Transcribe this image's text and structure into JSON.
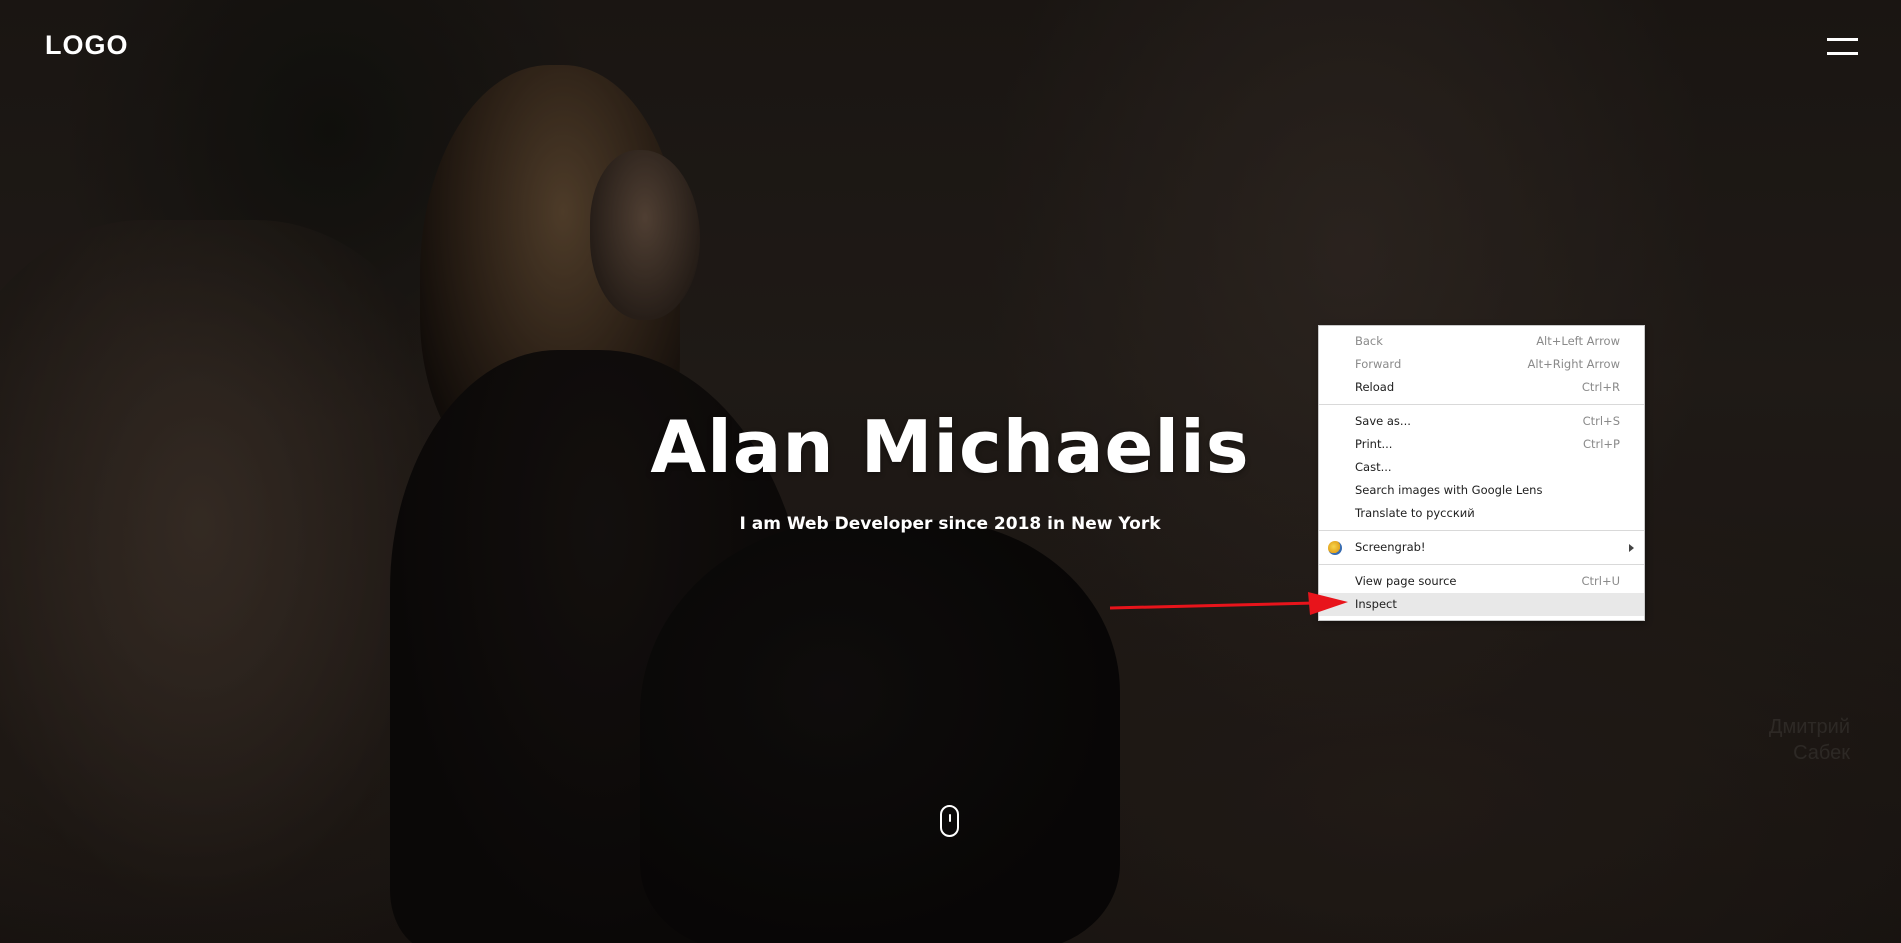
{
  "header": {
    "logo": "LOGO",
    "menu_icon": "hamburger-icon"
  },
  "hero": {
    "title": "Alan Michaelis",
    "subtitle": "I am Web Developer since 2018 in New York",
    "scroll_icon": "mouse-scroll-icon",
    "watermark_lines": [
      "Дмитрий",
      "Сабек"
    ]
  },
  "context_menu": {
    "groups": [
      [
        {
          "label": "Back",
          "shortcut": "Alt+Left Arrow",
          "disabled": true
        },
        {
          "label": "Forward",
          "shortcut": "Alt+Right Arrow",
          "disabled": true
        },
        {
          "label": "Reload",
          "shortcut": "Ctrl+R",
          "disabled": false
        }
      ],
      [
        {
          "label": "Save as...",
          "shortcut": "Ctrl+S",
          "disabled": false
        },
        {
          "label": "Print...",
          "shortcut": "Ctrl+P",
          "disabled": false
        },
        {
          "label": "Cast...",
          "shortcut": "",
          "disabled": false
        },
        {
          "label": "Search images with Google Lens",
          "shortcut": "",
          "disabled": false
        },
        {
          "label": "Translate to русский",
          "shortcut": "",
          "disabled": false
        }
      ],
      [
        {
          "label": "Screengrab!",
          "shortcut": "",
          "disabled": false,
          "icon": "screengrab-icon",
          "submenu": true
        }
      ],
      [
        {
          "label": "View page source",
          "shortcut": "Ctrl+U",
          "disabled": false
        },
        {
          "label": "Inspect",
          "shortcut": "",
          "disabled": false,
          "highlighted": true
        }
      ]
    ]
  },
  "annotation": {
    "arrow_color": "#e8141b",
    "arrow_icon": "red-arrow-pointer"
  }
}
